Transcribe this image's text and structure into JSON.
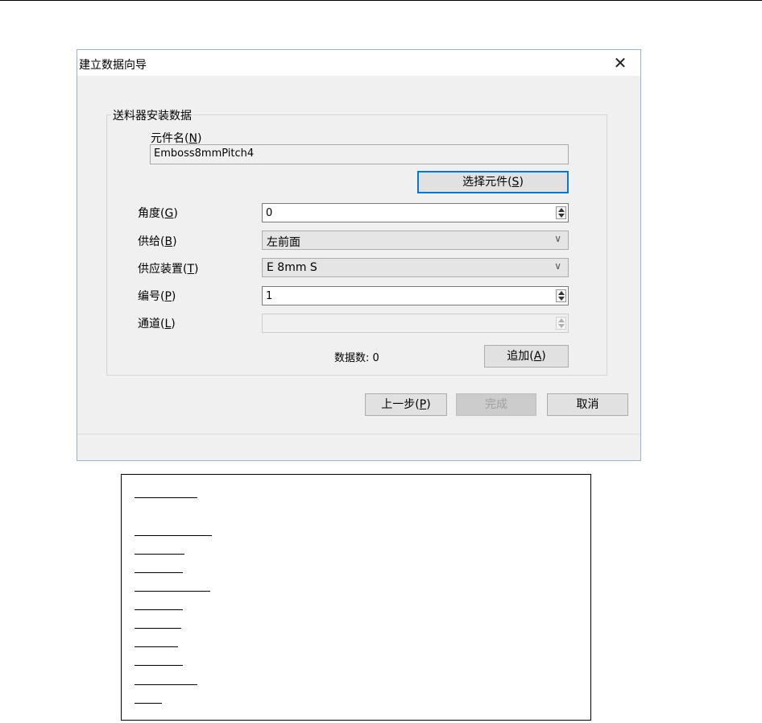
{
  "dialog": {
    "title": "建立数据向导",
    "close_glyph": "✕",
    "group_title": "送料器安装数据",
    "component_name": {
      "label_text": "元件名(",
      "label_key": "N",
      "label_end": ")",
      "value": "Emboss8mmPitch4"
    },
    "select_button": {
      "text": "选择元件(",
      "key": "S",
      "end": ")"
    },
    "fields": {
      "angle": {
        "text": "角度(",
        "key": "G",
        "end": ")",
        "value": "0"
      },
      "supply": {
        "text": "供给(",
        "key": "B",
        "end": ")",
        "value": "左前面"
      },
      "device": {
        "text": "供应装置(",
        "key": "T",
        "end": ")",
        "value": "E 8mm S"
      },
      "number": {
        "text": "编号(",
        "key": "P",
        "end": ")",
        "value": "1"
      },
      "channel": {
        "text": "通道(",
        "key": "L",
        "end": ")",
        "value": ""
      }
    },
    "data_count": "数据数: 0",
    "add_button": {
      "text": "追加(",
      "key": "A",
      "end": ")"
    },
    "prev_button": {
      "text": "上一步(",
      "key": "P",
      "end": ")"
    },
    "finish_button": "完成",
    "cancel_button": "取消"
  }
}
